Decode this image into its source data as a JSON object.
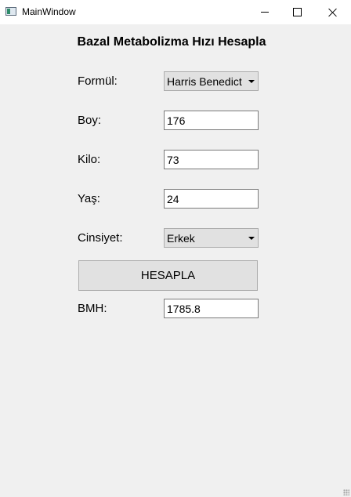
{
  "window": {
    "title": "MainWindow",
    "controls": [
      "minimize-icon",
      "maximize-icon",
      "close-icon"
    ]
  },
  "form": {
    "heading": "Bazal Metabolizma Hızı Hesapla",
    "formula": {
      "label": "Formül:",
      "selected": "Harris Benedict"
    },
    "height": {
      "label": "Boy:",
      "value": "176"
    },
    "weight": {
      "label": "Kilo:",
      "value": "73"
    },
    "age": {
      "label": "Yaş:",
      "value": "24"
    },
    "gender": {
      "label": "Cinsiyet:",
      "selected": "Erkek"
    },
    "calculate_label": "HESAPLA",
    "result": {
      "label": "BMH:",
      "value": "1785.8"
    }
  }
}
